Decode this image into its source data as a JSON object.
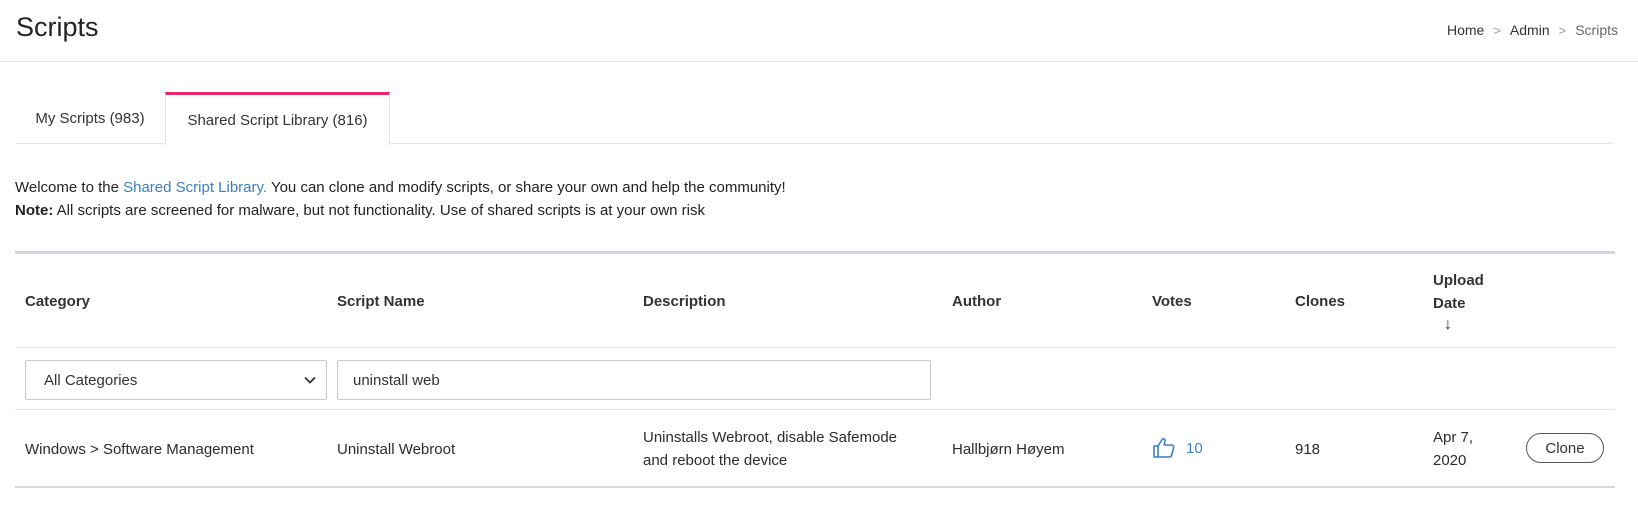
{
  "header": {
    "title": "Scripts",
    "breadcrumb": {
      "home": "Home",
      "admin": "Admin",
      "current": "Scripts",
      "separator": ">"
    }
  },
  "tabs": [
    {
      "label": "My Scripts (983)",
      "active": false
    },
    {
      "label": "Shared Script Library (816)",
      "active": true
    }
  ],
  "intro": {
    "line1_prefix": "Welcome to the ",
    "line1_link": "Shared Script Library.",
    "line1_suffix": " You can clone and modify scripts, or share your own and help the community!",
    "note_label": "Note:",
    "note_text": " All scripts are screened for malware, but not functionality. Use of shared scripts is at your own risk"
  },
  "table": {
    "columns": {
      "category": "Category",
      "script_name": "Script Name",
      "description": "Description",
      "author": "Author",
      "votes": "Votes",
      "clones": "Clones",
      "upload_date": "Upload Date",
      "sort_indicator": "↓"
    },
    "filters": {
      "category_selected": "All Categories",
      "search_value": "uninstall web"
    },
    "rows": [
      {
        "category": "Windows > Software Management",
        "script_name": "Uninstall Webroot",
        "description": "Uninstalls Webroot, disable Safemode and reboot the device",
        "author": "Hallbjørn Høyem",
        "votes": "10",
        "clones": "918",
        "upload_date": "Apr 7, 2020",
        "action": "Clone"
      }
    ]
  },
  "colors": {
    "accent_tab": "#e8286d",
    "link": "#3c7fc1",
    "table_border": "#cfd6df"
  },
  "icons": {
    "votes": "thumbs-up-icon",
    "select": "chevron-down-icon"
  }
}
